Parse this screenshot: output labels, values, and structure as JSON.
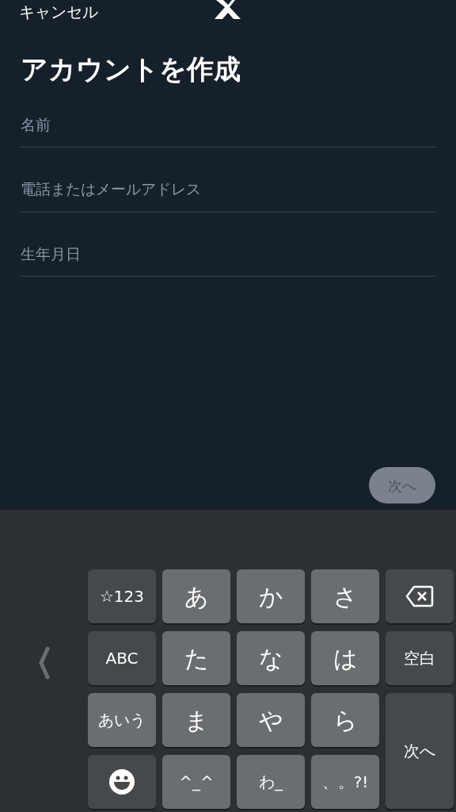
{
  "header": {
    "cancel": "キャンセル"
  },
  "title": "アカウントを作成",
  "fields": [
    {
      "placeholder": "名前"
    },
    {
      "placeholder": "電話またはメールアドレス"
    },
    {
      "placeholder": "生年月日"
    }
  ],
  "next_button": {
    "label": "次へ",
    "disabled": true
  },
  "keyboard": {
    "keys": [
      {
        "kind": "function",
        "label": "☆123"
      },
      {
        "kind": "char",
        "label": "あ"
      },
      {
        "kind": "char",
        "label": "か"
      },
      {
        "kind": "char",
        "label": "さ"
      },
      {
        "kind": "backspace"
      },
      {
        "kind": "function",
        "label": "ABC"
      },
      {
        "kind": "char",
        "label": "た"
      },
      {
        "kind": "char",
        "label": "な"
      },
      {
        "kind": "char",
        "label": "は"
      },
      {
        "kind": "function",
        "label": "空白"
      },
      {
        "kind": "char",
        "label": "あいう"
      },
      {
        "kind": "char",
        "label": "ま"
      },
      {
        "kind": "char",
        "label": "や"
      },
      {
        "kind": "char",
        "label": "ら"
      },
      {
        "kind": "tall",
        "label": "次へ"
      },
      {
        "kind": "emoji"
      },
      {
        "kind": "char",
        "label": "^_^"
      },
      {
        "kind": "char",
        "label": "わ_"
      },
      {
        "kind": "char",
        "label": "、。?!"
      }
    ]
  }
}
